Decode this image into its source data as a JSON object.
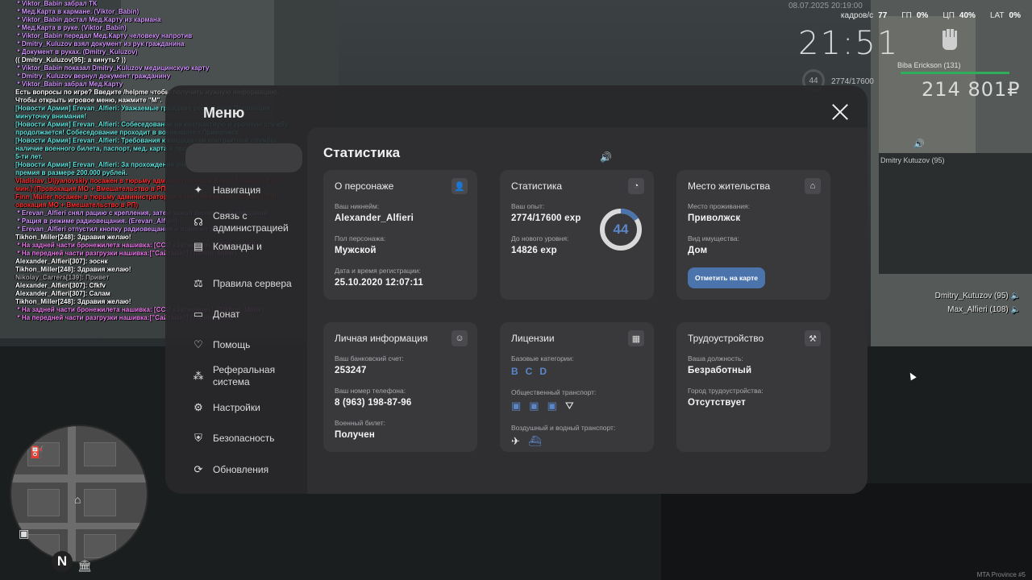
{
  "chat": [
    {
      "c": "c-me",
      "t": " * Viktor_Babin забрал ТК"
    },
    {
      "c": "c-me",
      "t": " * Мед.Карта в кармане. (Viktor_Babin)"
    },
    {
      "c": "c-me",
      "t": " * Viktor_Babin достал Мед.Карту из кармана"
    },
    {
      "c": "c-me",
      "t": " * Мед.Карта в руке. (Viktor_Babin)"
    },
    {
      "c": "c-me",
      "t": " * Viktor_Babin передал Мед.Карту человеку напротив"
    },
    {
      "c": "c-me",
      "t": " * Dmitry_Kuluzov взял документ из рук гражданина"
    },
    {
      "c": "c-me",
      "t": " * Документ в руках. (Dmitry_Kuluzov)"
    },
    {
      "c": "c-w",
      "t": "(( Dmitry_Kuluzov[95]: а кинуть? ))"
    },
    {
      "c": "c-me",
      "t": " * Viktor_Babin показал Dmitry_Kuluzov медицинскую карту"
    },
    {
      "c": "c-me",
      "t": " * Dmitry_Kuluzov вернул документ гражданину"
    },
    {
      "c": "c-me",
      "t": " * Viktor_Babin забрал Мед.Карту"
    },
    {
      "c": "c-hint",
      "t": "Есть вопросы по игре? Введите /helpme чтобы получить нужную информацию."
    },
    {
      "c": "c-hint",
      "t": "Чтобы открыть игровое меню, нажмите \"M\"."
    },
    {
      "c": "c-news",
      "t": "[Новости Армия] Erevan_Alfieri: Уважаемые граждане республики Провинция, минуточку внимания!"
    },
    {
      "c": "c-news",
      "t": "[Новости Армия] Erevan_Alfieri: Собеседование на контрактную и срочную службу продолжается! Собеседование проходит в военкомате г.Приволжск."
    },
    {
      "c": "c-news",
      "t": "[Новости Армия] Erevan_Alfieri: Требования к кандидатам контрактной службы: наличие военного билета, паспорт, мед. карта и прописка в республике не менее 5-ти лет."
    },
    {
      "c": "c-news",
      "t": "[Новости Армия] Erevan_Alfieri: За прохождение учебного центра вып лачивается премия в размере 200.000 рублей."
    },
    {
      "c": "c-red",
      "t": "Vladislav_Uljyanovskiy посажен в тюрьму администратором Kevin_Maskelyne (30 мин.) (Провокация МО + Вмешательство в РП)"
    },
    {
      "c": "c-red",
      "t": "Finn_Muller посажен в тюрьму администратором Kevin_Maskelyne (30 мин.) (Пр овокация МО + Вмешательство в РП)"
    },
    {
      "c": "c-me",
      "t": " * Erevan_Alfieri снял рацию с крепления, затем зажал кнопку радиовещания"
    },
    {
      "c": "c-me",
      "t": " * Рация в режиме радиовещания. (Erevan_Alfieri)"
    },
    {
      "c": "c-me",
      "t": " * Erevan_Alfieri отпустил кнопку радиовещания и повесил рацию на крепление"
    },
    {
      "c": "c-w",
      "t": "Tikhon_Miller[248]: Здравия желаю!"
    },
    {
      "c": "c-pink",
      "t": " * На задней части бронежилета нашивка: [ССО «Затмение»]. (Tikhon_Miller)"
    },
    {
      "c": "c-pink",
      "t": " * На передней части разгрузки нашивка:[\"Сайтама\"] (Tikhon_Miller)"
    },
    {
      "c": "c-w",
      "t": "Alexander_Alfieri[307]: эоснк"
    },
    {
      "c": "c-w",
      "t": "Tikhon_Miller[248]: Здравия желаю!"
    },
    {
      "c": "c-g",
      "t": "Nikolay_Carrera[139]: Привет"
    },
    {
      "c": "c-w",
      "t": "Alexander_Alfieri[307]: Cfkfv"
    },
    {
      "c": "c-w",
      "t": "Alexander_Alfieri[307]: Салам"
    },
    {
      "c": "c-w",
      "t": "Tikhon_Miller[248]: Здравия желаю!"
    },
    {
      "c": "c-pink",
      "t": " * На задней части бронежилета нашивка: [ССО «Затмение»]. (Tikhon_Miller)"
    },
    {
      "c": "c-pink",
      "t": " * На передней части разгрузки нашивка:[\"Сайтама\"] (Tikhon_Miller)"
    }
  ],
  "hud": {
    "date": "08.07.2025 20:19:00",
    "fps_label": "кадров/с",
    "fps": "77",
    "gpu_label": "ГП",
    "gpu": "0%",
    "cpu_label": "ЦП",
    "cpu": "40%",
    "lat_label": "LAT",
    "lat": "0%",
    "time": "21:51",
    "level": "44",
    "xp": "2774/17600",
    "player_name": "Biba Erickson (131)",
    "money": "214 801₽",
    "near_player": "Dmitry Kutuzov (95)",
    "voice": [
      "Dmitry_Kutuzov (95)",
      "Max_Alfieri (108)"
    ],
    "server": "MTA Province #5"
  },
  "menu": {
    "title": "Меню",
    "nav": [
      {
        "icon": "navigation-icon",
        "label": "Навигация"
      },
      {
        "icon": "headset-icon",
        "label": "Связь с администрацией"
      },
      {
        "icon": "commands-icon",
        "label": "Команды и"
      },
      {
        "icon": "scales-icon",
        "label": "Правила сервера"
      },
      {
        "icon": "donate-icon",
        "label": "Донат"
      },
      {
        "icon": "heart-icon",
        "label": "Помощь"
      },
      {
        "icon": "referral-icon",
        "label": "Реферальная система"
      },
      {
        "icon": "gear-icon",
        "label": "Настройки"
      },
      {
        "icon": "shield-icon",
        "label": "Безопасность"
      },
      {
        "icon": "update-icon",
        "label": "Обновления"
      }
    ]
  },
  "stats": {
    "title": "Статистика",
    "character": {
      "title": "О персонаже",
      "nick_label": "Ваш никнейм:",
      "nick": "Alexander_Alfieri",
      "gender_label": "Пол персонажа:",
      "gender": "Мужской",
      "reg_label": "Дата и время регистрации:",
      "reg": "25.10.2020 12:07:11"
    },
    "progress": {
      "title": "Статистика",
      "exp_label": "Ваш опыт:",
      "exp": "2774/17600 exp",
      "next_label": "До нового уровня:",
      "next": "14826 exp",
      "level": "44",
      "level_fraction": 0.158
    },
    "residence": {
      "title": "Место жительства",
      "city_label": "Место проживания:",
      "city": "Приволжск",
      "prop_label": "Вид имущества:",
      "prop": "Дом",
      "button": "Отметить на карте"
    },
    "personal": {
      "title": "Личная информация",
      "bank_label": "Ваш банковский счет:",
      "bank": "253247",
      "phone_label": "Ваш номер телефона:",
      "phone": "8 (963) 198-87-96",
      "military_label": "Военный билет:",
      "military": "Получен"
    },
    "licenses": {
      "title": "Лицензии",
      "base_label": "Базовые категории:",
      "base": [
        "B",
        "C",
        "D"
      ],
      "public_label": "Общественный транспорт:",
      "air_label": "Воздушный и водный транспорт:"
    },
    "job": {
      "title": "Трудоустройство",
      "pos_label": "Ваша должность:",
      "pos": "Безработный",
      "city_label": "Город трудоустройства:",
      "city": "Отсутствует"
    }
  },
  "colors": {
    "accent": "#4b74ad",
    "license": "#5b87c9",
    "hp": "#2fae5a"
  }
}
